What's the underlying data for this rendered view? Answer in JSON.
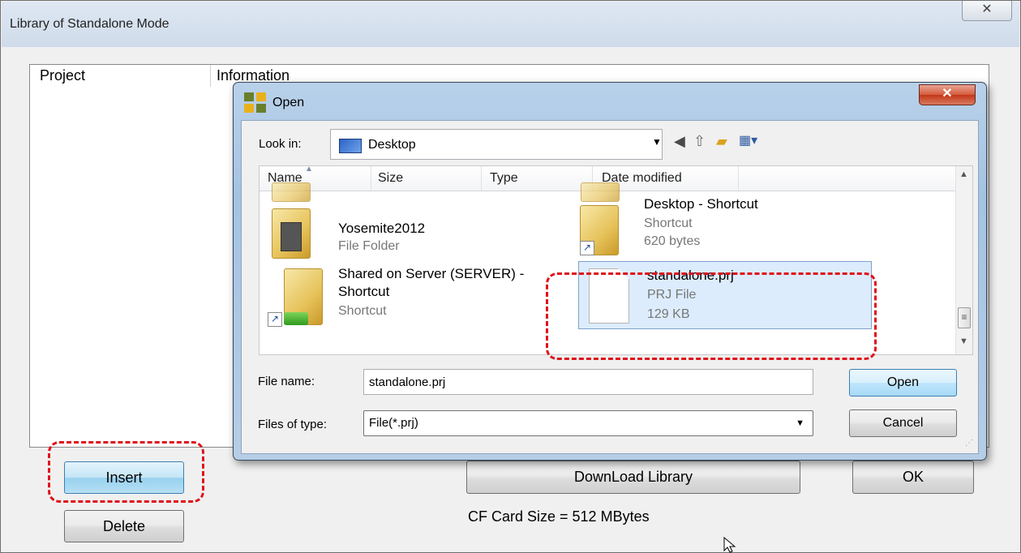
{
  "outer": {
    "title": "Library of Standalone Mode",
    "close_glyph": "✕",
    "columns": [
      "Project",
      "Information"
    ],
    "insert_label": "Insert",
    "delete_label": "Delete",
    "download_label": "DownLoad Library",
    "ok_label": "OK",
    "cf_size": "CF Card Size = 512 MBytes"
  },
  "dialog": {
    "title": "Open",
    "close_glyph": "✕",
    "look_in_label": "Look in:",
    "look_in_value": "Desktop",
    "columns": [
      "Name",
      "Size",
      "Type",
      "Date modified"
    ],
    "items": [
      {
        "name": "Yosemite2012",
        "sub1": "File Folder",
        "sub2": ""
      },
      {
        "name": "Desktop - Shortcut",
        "sub1": "Shortcut",
        "sub2": "620 bytes"
      },
      {
        "name1": "Shared on Server (SERVER) -",
        "name2": "Shortcut",
        "sub1": "Shortcut"
      },
      {
        "name": "standalone.prj",
        "sub1": "PRJ File",
        "sub2": "129 KB"
      }
    ],
    "file_name_label": "File name:",
    "file_name_value": "standalone.prj",
    "files_of_type_label": "Files of type:",
    "files_of_type_value": "File(*.prj)",
    "open_label": "Open",
    "cancel_label": "Cancel"
  },
  "icons": {
    "back": "back-icon",
    "up": "up-folder-icon",
    "new_folder": "new-folder-icon",
    "views": "views-menu-icon"
  },
  "colors": {
    "highlight": "#e0101a",
    "selection": "#dcecfc"
  }
}
